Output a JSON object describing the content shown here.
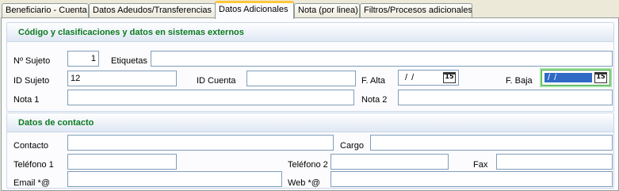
{
  "tabs": [
    {
      "label": "Beneficiario - Cuenta"
    },
    {
      "label": "Datos Adeudos/Transferencias"
    },
    {
      "label": "Datos Adicionales"
    },
    {
      "label": "Nota (por linea)"
    },
    {
      "label": "Filtros/Procesos adicionales"
    }
  ],
  "section1": {
    "title": "Código y clasificaciones y datos en sistemas externos",
    "n_sujeto": {
      "label": "Nº Sujeto",
      "value": "1"
    },
    "etiquetas": {
      "label": "Etiquetas",
      "value": ""
    },
    "id_sujeto": {
      "label": "ID Sujeto",
      "value": "12"
    },
    "id_cuenta": {
      "label": "ID Cuenta",
      "value": ""
    },
    "f_alta": {
      "label": "F. Alta",
      "value": "/ /",
      "cal_icon": "calendar-icon",
      "cal_text": "15"
    },
    "f_baja": {
      "label": "F. Baja",
      "value": "/ /",
      "cal_icon": "calendar-icon",
      "cal_text": "15"
    },
    "nota1": {
      "label": "Nota 1",
      "value": ""
    },
    "nota2": {
      "label": "Nota 2",
      "value": ""
    }
  },
  "section2": {
    "title": "Datos de contacto",
    "contacto": {
      "label": "Contacto",
      "value": ""
    },
    "cargo": {
      "label": "Cargo",
      "value": ""
    },
    "telefono1": {
      "label": "Teléfono 1",
      "value": ""
    },
    "telefono2": {
      "label": "Teléfono 2",
      "value": ""
    },
    "fax": {
      "label": "Fax",
      "value": ""
    },
    "email": {
      "label": "Email  *@",
      "value": ""
    },
    "web": {
      "label": "Web *@",
      "value": ""
    }
  },
  "colors": {
    "section_title": "#0d7a20",
    "active_tab_accent": "#ffc83c",
    "selection": "#316ac5",
    "focus_glow": "#9fe39f"
  }
}
